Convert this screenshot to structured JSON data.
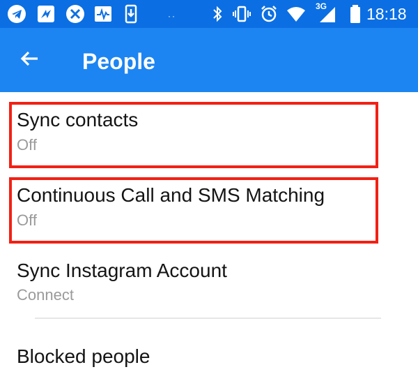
{
  "status_bar": {
    "icons": [
      "telegram-icon",
      "app-icon",
      "xbox-icon",
      "activity-icon",
      "download-icon",
      "bluetooth-icon",
      "vibrate-icon",
      "alarm-icon",
      "wifi-icon",
      "signal-icon",
      "battery-icon"
    ],
    "dots": "··",
    "network": "3G",
    "time": "18:18"
  },
  "app_bar": {
    "back_icon": "arrow-back-icon",
    "title": "People"
  },
  "settings": [
    {
      "title": "Sync contacts",
      "subtitle": "Off",
      "highlighted": true
    },
    {
      "title": "Continuous Call and SMS Matching",
      "subtitle": "Off",
      "highlighted": true
    },
    {
      "title": "Sync Instagram Account",
      "subtitle": "Connect",
      "highlighted": false
    },
    {
      "title": "Blocked people",
      "subtitle": "",
      "highlighted": false
    }
  ],
  "colors": {
    "status_bar": "#0b6fe3",
    "app_bar": "#1c85f2",
    "highlight_box": "#f22014",
    "subtitle_text": "#9a9a9a"
  }
}
